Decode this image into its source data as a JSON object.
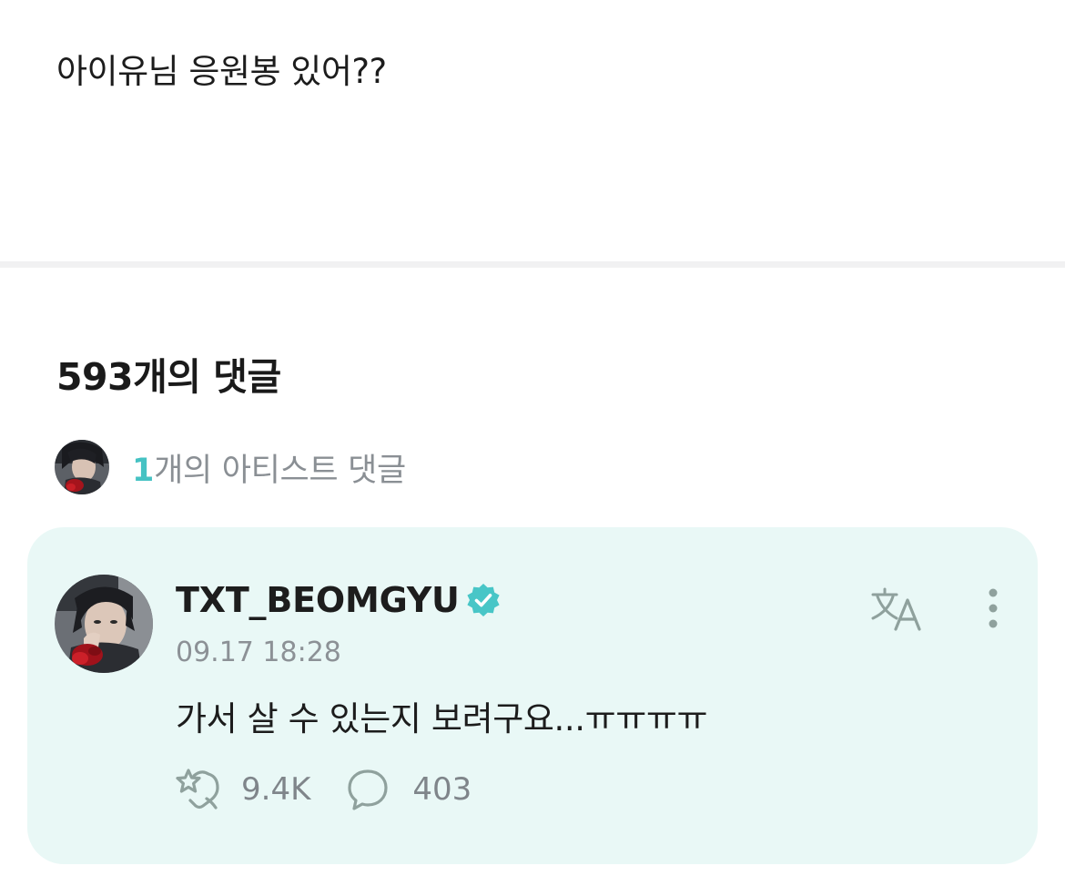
{
  "post": {
    "body_text": "아이유님 응원봉 있어??"
  },
  "comments_section": {
    "heading": "593개의 댓글",
    "artist_summary": {
      "count": "1",
      "label": "개의 아티스트 댓글"
    }
  },
  "artist_comment": {
    "author": "TXT_BEOMGYU",
    "timestamp": "09.17 18:28",
    "text": "가서 살 수 있는지 보려구요...ㅠㅠㅠㅠ",
    "likes": "9.4K",
    "replies": "403",
    "icons": {
      "verified": "verified-badge-icon",
      "translate": "translate-icon",
      "more": "more-vertical-icon",
      "like": "like-icon",
      "reply": "reply-bubble-icon"
    }
  },
  "colors": {
    "accent": "#45c2c3",
    "card_background": "#e9f8f6",
    "muted_text": "#8a8f94",
    "icon_gray": "#8fa19d"
  }
}
